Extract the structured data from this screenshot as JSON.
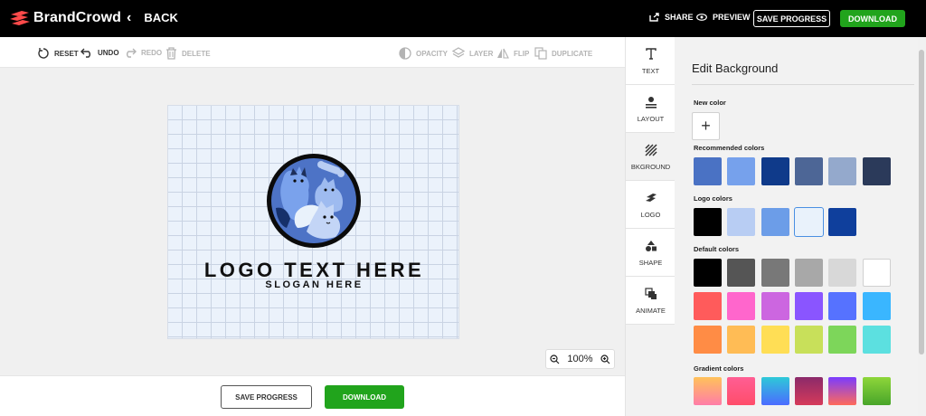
{
  "header": {
    "brand": "BrandCrowd",
    "back_label": "BACK",
    "share_label": "SHARE",
    "preview_label": "PREVIEW",
    "save_label": "SAVE PROGRESS",
    "download_label": "DOWNLOAD"
  },
  "toolbar": {
    "reset": "RESET",
    "undo": "UNDO",
    "redo": "REDO",
    "delete": "DELETE",
    "opacity": "OPACITY",
    "layer": "LAYER",
    "flip": "FLIP",
    "duplicate": "DUPLICATE"
  },
  "canvas": {
    "logo_text": "LOGO TEXT HERE",
    "slogan": "SLOGAN HERE",
    "zoom": "100%"
  },
  "bottom": {
    "save_label": "SAVE PROGRESS",
    "download_label": "DOWNLOAD"
  },
  "sidenav": [
    {
      "label": "TEXT",
      "icon": "text-icon"
    },
    {
      "label": "LAYOUT",
      "icon": "layout-icon"
    },
    {
      "label": "BKGROUND",
      "icon": "background-icon",
      "active": true
    },
    {
      "label": "LOGO",
      "icon": "logo-icon"
    },
    {
      "label": "SHAPE",
      "icon": "shape-icon"
    },
    {
      "label": "ANIMATE",
      "icon": "animate-icon"
    }
  ],
  "panel": {
    "title": "Edit Background",
    "new_color_label": "New color",
    "recommended_label": "Recommended colors",
    "logo_colors_label": "Logo colors",
    "default_label": "Default colors",
    "gradient_label": "Gradient colors",
    "recommended_colors": [
      "#4a72c4",
      "#76a1ec",
      "#0f3a8a",
      "#4d6696",
      "#94a9cc",
      "#2b3a5a"
    ],
    "logo_colors": [
      "#000000",
      "#b8cdf3",
      "#6c9de8",
      "#e9f2fb",
      "#0f3f9c"
    ],
    "default_colors": [
      "#000000",
      "#555555",
      "#787878",
      "#a8a8a8",
      "#d8d8d8",
      "#ffffff",
      "#ff5b5b",
      "#ff66cc",
      "#cc66e0",
      "#8a55ff",
      "#5672ff",
      "#3ab6ff",
      "#ff8c45",
      "#ffbc55",
      "#ffde55",
      "#c8e05a",
      "#7dd65a",
      "#5ce0e0"
    ],
    "gradient_colors": [
      [
        "#ffc25a",
        "#ff7ca8"
      ],
      [
        "#ff5e94",
        "#ff4d6a"
      ],
      [
        "#2ec9d8",
        "#4b6bff"
      ],
      [
        "#8b2a6a",
        "#d63a5a"
      ],
      [
        "#7a3cff",
        "#ff6a5a"
      ],
      [
        "#8ed63a",
        "#48a52a"
      ]
    ]
  }
}
